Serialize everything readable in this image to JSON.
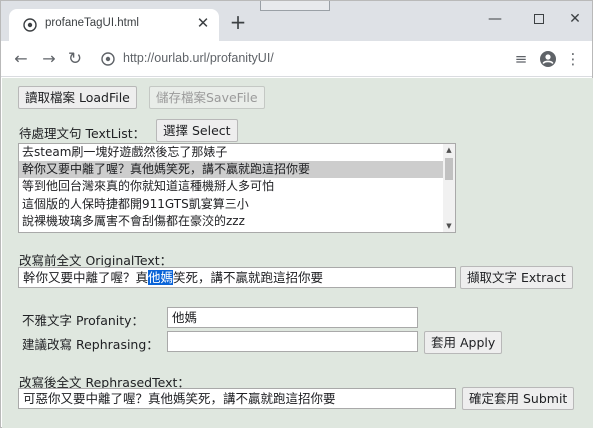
{
  "browser": {
    "tab_title": "profaneTagUI.html",
    "url": "http://ourlab.url/profanityUI/",
    "icons": {
      "favicon": "globe-icon",
      "close": "close-icon",
      "new_tab": "plus-icon",
      "back": "back-arrow-icon",
      "forward": "forward-arrow-icon",
      "reload": "reload-icon",
      "site_info": "globe-icon",
      "reading_list": "reading-list-icon",
      "profile": "profile-icon",
      "menu": "kebab-menu-icon"
    }
  },
  "page": {
    "load_button": "讀取檔案 LoadFile",
    "save_button": "儲存檔案SaveFile",
    "textlist_label": "待處理文句 TextList：",
    "select_button": "選擇 Select",
    "text_list": [
      "去steam刷一塊好遊戲然後忘了那婊子",
      "幹你又要中離了喔？真他媽笑死，講不贏就跑這招你要",
      "等到他回台灣來真的你就知道這種機掰人多可怕",
      "這個版的人保時捷都開911GTS凱宴算三小",
      "說裸機玻璃多厲害不會刮傷都在豪洨的zzz"
    ],
    "selected_index": 1,
    "original_label": "改寫前全文 OriginalText：",
    "original_text_before": "幹你又要中離了喔？真",
    "original_text_selected": "他媽",
    "original_text_after": "笑死，講不贏就跑這招你要",
    "extract_button": "擷取文字 Extract",
    "profanity_label": "不雅文字 Profanity：",
    "profanity_value": "他媽",
    "rephrasing_label": "建議改寫 Rephrasing：",
    "rephrasing_value": "",
    "apply_button": "套用 Apply",
    "rephrased_label": "改寫後全文 RephrasedText：",
    "rephrased_value": "可惡你又要中離了喔？真他媽笑死，講不贏就跑這招你要",
    "submit_button": "確定套用 Submit"
  },
  "colors": {
    "page_background": "#dfe7df",
    "selection": "#0a64d8",
    "list_selected": "#cdcdcd"
  }
}
